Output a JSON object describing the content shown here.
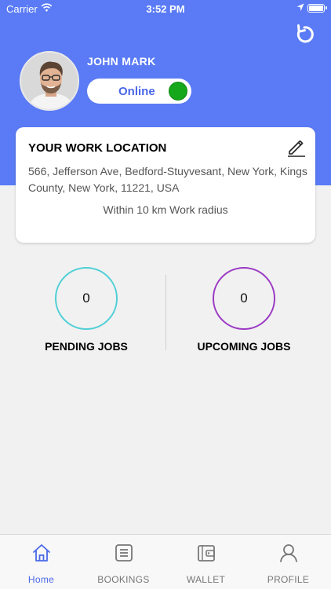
{
  "status_bar": {
    "carrier": "Carrier",
    "time": "3:52 PM",
    "wifi_icon": "wifi-icon",
    "location_icon": "location-arrow-icon",
    "battery_icon": "battery-icon"
  },
  "header": {
    "background_color": "#5a7bf5",
    "refresh_icon": "refresh-icon",
    "user_name": "JOHN MARK",
    "availability": {
      "label": "Online",
      "state": "on",
      "indicator_color": "#15a81a"
    }
  },
  "work_location": {
    "title": "YOUR WORK LOCATION",
    "edit_icon": "pencil-icon",
    "address": "566, Jefferson Ave, Bedford-Stuyvesant, New York, Kings County, New York, 11221, USA",
    "radius_text": "Within 10 km Work radius"
  },
  "stats": {
    "pending": {
      "value": "0",
      "label": "PENDING JOBS",
      "ring_color": "#4fcfd6"
    },
    "upcoming": {
      "value": "0",
      "label": "UPCOMING JOBS",
      "ring_color": "#9b39c4"
    }
  },
  "tabbar": {
    "active_color": "#4a68e8",
    "items": [
      {
        "label": "Home",
        "icon": "home-icon",
        "active": true
      },
      {
        "label": "BOOKINGS",
        "icon": "list-icon",
        "active": false
      },
      {
        "label": "WALLET",
        "icon": "wallet-icon",
        "active": false
      },
      {
        "label": "PROFILE",
        "icon": "user-icon",
        "active": false
      }
    ]
  }
}
